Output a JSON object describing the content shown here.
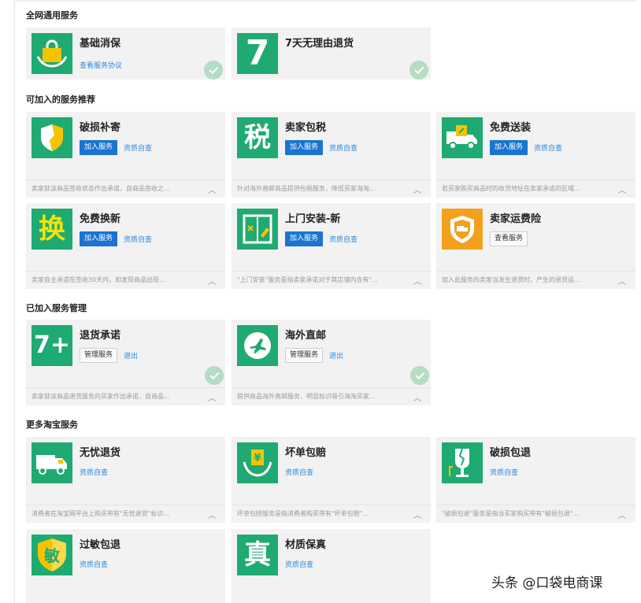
{
  "sections": {
    "general": "全网通用服务",
    "recommended": "可加入的服务推荐",
    "joined": "已加入服务管理",
    "more": "更多淘宝服务"
  },
  "general_cards": [
    {
      "title": "基础消保",
      "link": "查看服务协议",
      "icon": "shopping-bag-icon"
    },
    {
      "title": "7天无理由退货",
      "icon": "seven-days-icon",
      "glyph": "7"
    }
  ],
  "recommended_cards": [
    {
      "title": "破损补寄",
      "btn": "加入服务",
      "link": "资质自查",
      "desc": "卖家就该商品签收状态作出承诺，自商品签收之...",
      "icon": "broken-shield-icon"
    },
    {
      "title": "卖家包税",
      "btn": "加入服务",
      "link": "资质自查",
      "desc": "针对海外直邮商品提供包税服务，降低买家海淘...",
      "icon": "tax-icon",
      "glyph": "税"
    },
    {
      "title": "免费送装",
      "btn": "加入服务",
      "link": "资质自查",
      "desc": "若买家购买商品时的收货地址在卖家承诺的区域...",
      "icon": "delivery-truck-icon"
    },
    {
      "title": "免费换新",
      "btn": "加入服务",
      "link": "资质自查",
      "desc": "卖家自主承诺在签收30天内，如发现商品出现...",
      "icon": "exchange-icon",
      "glyph": "换"
    },
    {
      "title": "上门安装-新",
      "btn": "加入服务",
      "link": "资质自查",
      "desc": "\"上门安装\"服务是指卖家承诺对于其店铺内含有\"...",
      "icon": "install-tool-icon"
    },
    {
      "title": "卖家运费险",
      "btn_default": "查看服务",
      "desc": "加入此服务的卖家当发生退货时，产生的退货运...",
      "icon": "freight-insurance-icon"
    }
  ],
  "joined_cards": [
    {
      "title": "退货承诺",
      "btn_default": "管理服务",
      "link": "退出",
      "desc": "卖家就该商品退货服务向买家作出承诺，自商品...",
      "icon": "seven-plus-icon",
      "glyph": "7+"
    },
    {
      "title": "海外直邮",
      "btn_default": "管理服务",
      "link": "退出",
      "desc": "提供商品海外直邮服务，明显标识吸引海淘买家...",
      "icon": "airplane-icon"
    }
  ],
  "more_cards": [
    {
      "title": "无忧退货",
      "link": "资质自查",
      "desc": "消费者在淘宝网平台上购买带有\"无忧退货\"标识...",
      "icon": "return-truck-icon"
    },
    {
      "title": "坏单包赔",
      "link": "资质自查",
      "desc": "坏单包赔服务是指消费者购买带有\"坏单包赔\"...",
      "icon": "yuan-hands-icon",
      "glyph": "¥"
    },
    {
      "title": "破损包退",
      "link": "资质自查",
      "desc": "\"破损包退\"服务是指当买家购买带有\"破损包退\"...",
      "icon": "broken-glass-icon"
    },
    {
      "title": "过敏包退",
      "link": "资质自查",
      "icon": "allergy-icon",
      "glyph": "敏"
    },
    {
      "title": "材质保真",
      "link": "资质自查",
      "icon": "genuine-icon",
      "glyph": "真"
    }
  ],
  "watermark": "头条 @口袋电商课",
  "colors": {
    "green": "#1faa72",
    "orange": "#f2a01e",
    "blue_button": "#1a74d0",
    "link": "#2b8ae0"
  }
}
